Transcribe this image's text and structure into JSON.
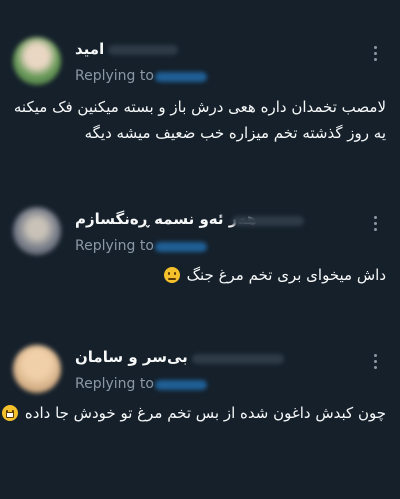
{
  "tweets": [
    {
      "name": "امید",
      "replying": "Replying to",
      "lines": [
        "لامصب تخمدان داره هعی درش باز و بسته میکنین فک میکنه",
        "یه روز گذشته تخم میزاره خب ضعیف میشه دیگه"
      ],
      "avatar_color": "#6a9a5a",
      "emoji": ""
    },
    {
      "name": "هەر ئەو نسمە ڕەنگسازم",
      "replying": "Replying to",
      "lines": [
        "داش میخوای بری تخم مرغ جنگ"
      ],
      "avatar_color": "#8a8f9a",
      "emoji": "slight-frown-emoji"
    },
    {
      "name": "بی‌سر و سامان",
      "replying": "Replying to",
      "lines": [
        "چون کبدش داغون شده از بس تخم مرغ تو خودش جا داده"
      ],
      "avatar_color": "#d8b48c",
      "emoji": "grinning-sweat-emoji"
    }
  ],
  "colors": {
    "background": "#15202b",
    "text": "#f7f9f9",
    "muted": "#8b98a5",
    "link": "#1d9bf0"
  }
}
